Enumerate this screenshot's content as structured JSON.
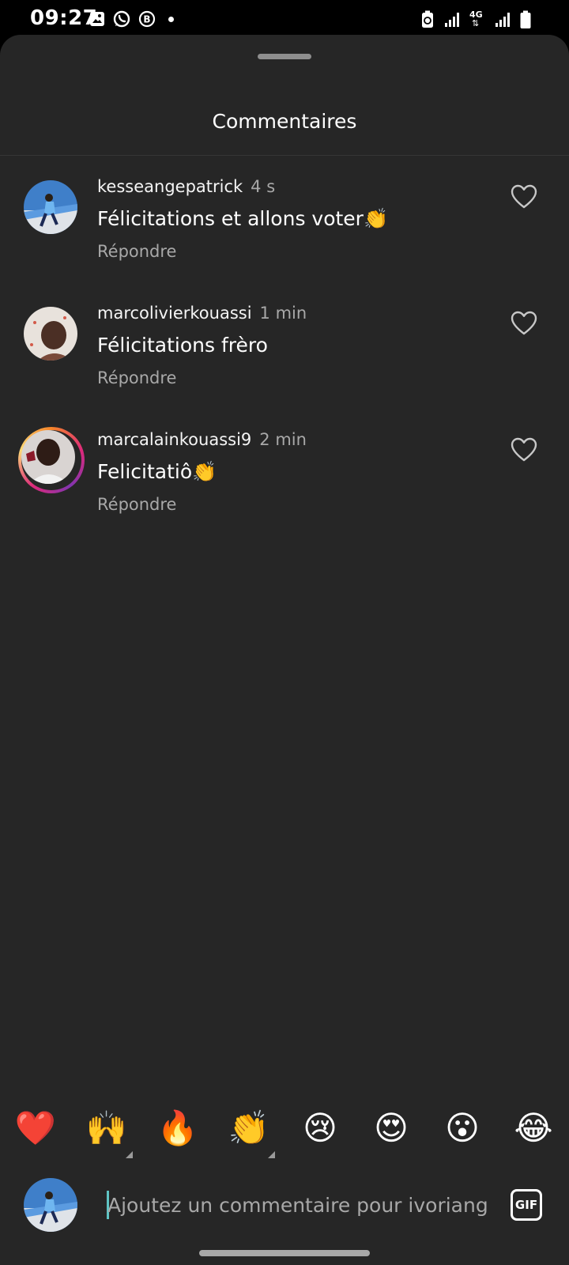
{
  "status_bar": {
    "time": "09:27",
    "left_icons": [
      "gallery-icon",
      "whatsapp-icon",
      "b-icon",
      "dot"
    ],
    "right_icons": [
      "battery-saver-icon",
      "signal-icon",
      "4g-icon",
      "signal-icon",
      "battery-icon"
    ],
    "network_label": "4G"
  },
  "sheet": {
    "title": "Commentaires"
  },
  "comments": [
    {
      "username": "kesseangepatrick",
      "time": "4 s",
      "text": "Félicitations et allons voter👏",
      "reply_label": "Répondre",
      "story_ring": false
    },
    {
      "username": "marcolivierkouassi",
      "time": "1 min",
      "text": "Félicitations frèro",
      "reply_label": "Répondre",
      "story_ring": false
    },
    {
      "username": "marcalainkouassi9",
      "time": "2 min",
      "text": "Felicitatiô👏",
      "reply_label": "Répondre",
      "story_ring": true
    }
  ],
  "quick_reactions": [
    "❤️",
    "🙌",
    "🔥",
    "👏",
    "😢",
    "😍",
    "😮",
    "😂"
  ],
  "composer": {
    "placeholder": "Ajoutez un commentaire pour ivoriangram...",
    "gif_label": "GIF"
  },
  "colors": {
    "sheet_bg": "#262626",
    "secondary_text": "#a8a8a8",
    "caret": "#5fc4c4"
  }
}
